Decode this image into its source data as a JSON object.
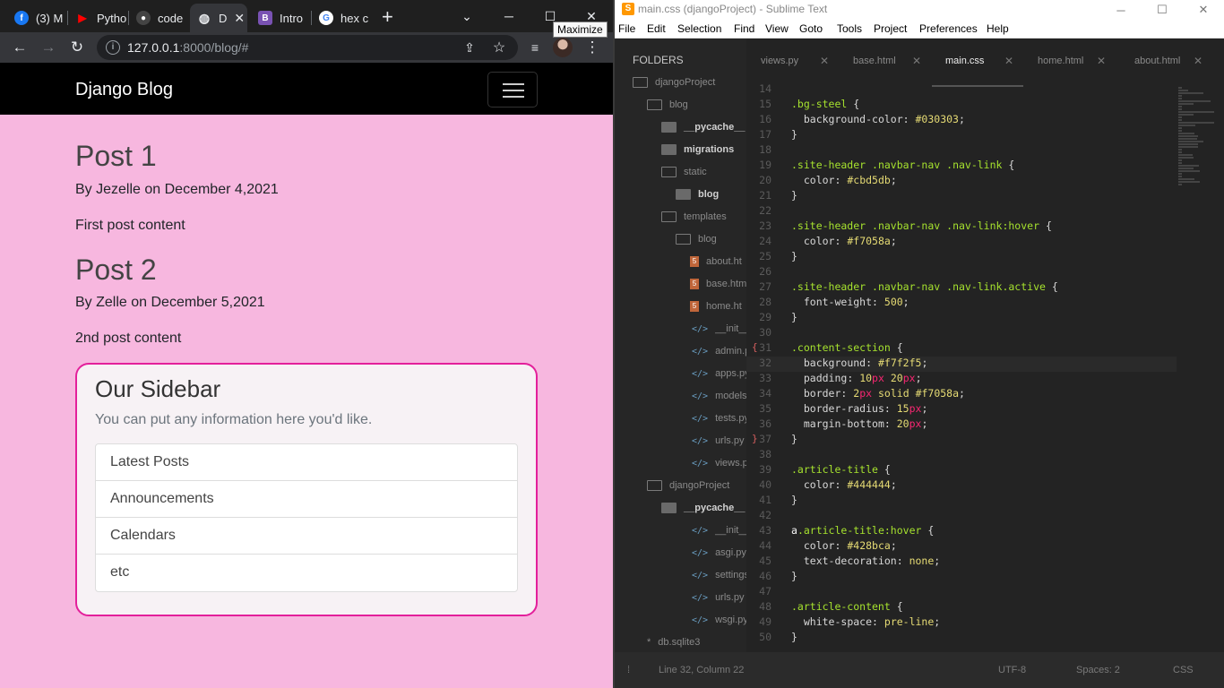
{
  "browser": {
    "tabs": [
      {
        "title": "(3) M",
        "icon": "facebook-icon",
        "color": "#1877f2"
      },
      {
        "title": "Pytho",
        "icon": "youtube-icon",
        "color": "#ff0000"
      },
      {
        "title": "code",
        "icon": "github-icon",
        "color": "#333333"
      },
      {
        "title": "D",
        "icon": "globe-icon",
        "color": "#5f6368"
      },
      {
        "title": "Intro",
        "icon": "bootstrap-icon",
        "color": "#7952b3"
      },
      {
        "title": "hex c",
        "icon": "google-icon",
        "color": "#4285f4"
      }
    ],
    "tooltip": "Maximize",
    "url_host": "127.0.0.1",
    "url_path": ":8000/blog/#"
  },
  "site": {
    "brand": "Django Blog",
    "posts": [
      {
        "title": "Post 1",
        "meta": "By Jezelle on December 4,2021",
        "content": "First post content"
      },
      {
        "title": "Post 2",
        "meta": "By Zelle on December 5,2021",
        "content": "2nd post content"
      }
    ],
    "sidebar": {
      "title": "Our Sidebar",
      "text": "You can put any information here you'd like.",
      "items": [
        "Latest Posts",
        "Announcements",
        "Calendars",
        "etc"
      ]
    }
  },
  "sublime": {
    "title": "main.css (djangoProject) - Sublime Text",
    "menu": [
      "File",
      "Edit",
      "Selection",
      "Find",
      "View",
      "Goto",
      "Tools",
      "Project",
      "Preferences",
      "Help"
    ],
    "folders_header": "FOLDERS",
    "tree": [
      {
        "label": "djangoProject",
        "type": "folder",
        "depth": 0,
        "style": "dim"
      },
      {
        "label": "blog",
        "type": "folder",
        "depth": 1,
        "style": "dim"
      },
      {
        "label": "__pycache__",
        "type": "folder-filled",
        "depth": 2,
        "style": "bold"
      },
      {
        "label": "migrations",
        "type": "folder-filled",
        "depth": 2,
        "style": "bold"
      },
      {
        "label": "static",
        "type": "folder",
        "depth": 2,
        "style": "dim"
      },
      {
        "label": "blog",
        "type": "folder-filled",
        "depth": 3,
        "style": "bold"
      },
      {
        "label": "templates",
        "type": "folder",
        "depth": 2,
        "style": "dim"
      },
      {
        "label": "blog",
        "type": "folder",
        "depth": 3,
        "style": "dim"
      },
      {
        "label": "about.ht",
        "type": "html",
        "depth": 4,
        "style": "dim"
      },
      {
        "label": "base.htm",
        "type": "html",
        "depth": 4,
        "style": "dim"
      },
      {
        "label": "home.ht",
        "type": "html",
        "depth": 4,
        "style": "dim"
      },
      {
        "label": "__init__.py",
        "type": "py",
        "depth": 2,
        "style": "dim"
      },
      {
        "label": "admin.py",
        "type": "py",
        "depth": 2,
        "style": "dim"
      },
      {
        "label": "apps.py",
        "type": "py",
        "depth": 2,
        "style": "dim"
      },
      {
        "label": "models.py",
        "type": "py",
        "depth": 2,
        "style": "dim"
      },
      {
        "label": "tests.py",
        "type": "py",
        "depth": 2,
        "style": "dim"
      },
      {
        "label": "urls.py",
        "type": "py",
        "depth": 2,
        "style": "dim"
      },
      {
        "label": "views.py",
        "type": "py",
        "depth": 2,
        "style": "dim"
      },
      {
        "label": "djangoProject",
        "type": "folder",
        "depth": 1,
        "style": "dim"
      },
      {
        "label": "__pycache__",
        "type": "folder-filled",
        "depth": 2,
        "style": "bold"
      },
      {
        "label": "__init__.py",
        "type": "py",
        "depth": 2,
        "style": "dim"
      },
      {
        "label": "asgi.py",
        "type": "py",
        "depth": 2,
        "style": "dim"
      },
      {
        "label": "settings.py",
        "type": "py",
        "depth": 2,
        "style": "dim"
      },
      {
        "label": "urls.py",
        "type": "py",
        "depth": 2,
        "style": "dim"
      },
      {
        "label": "wsgi.py",
        "type": "py",
        "depth": 2,
        "style": "dim"
      },
      {
        "label": "db.sqlite3",
        "type": "db",
        "depth": 1,
        "style": "dim"
      }
    ],
    "tabs": [
      {
        "label": "views.py",
        "active": false
      },
      {
        "label": "base.html",
        "active": false
      },
      {
        "label": "main.css",
        "active": true
      },
      {
        "label": "home.html",
        "active": false
      },
      {
        "label": "about.html",
        "active": false
      }
    ],
    "code_lines": [
      {
        "n": "14",
        "text": ""
      },
      {
        "n": "15",
        "text": ".bg-steel {"
      },
      {
        "n": "16",
        "text": "  background-color: #030303;"
      },
      {
        "n": "17",
        "text": "}"
      },
      {
        "n": "18",
        "text": ""
      },
      {
        "n": "19",
        "text": ".site-header .navbar-nav .nav-link {"
      },
      {
        "n": "20",
        "text": "  color: #cbd5db;"
      },
      {
        "n": "21",
        "text": "}"
      },
      {
        "n": "22",
        "text": ""
      },
      {
        "n": "23",
        "text": ".site-header .navbar-nav .nav-link:hover {"
      },
      {
        "n": "24",
        "text": "  color: #f7058a;"
      },
      {
        "n": "25",
        "text": "}"
      },
      {
        "n": "26",
        "text": ""
      },
      {
        "n": "27",
        "text": ".site-header .navbar-nav .nav-link.active {"
      },
      {
        "n": "28",
        "text": "  font-weight: 500;"
      },
      {
        "n": "29",
        "text": "}"
      },
      {
        "n": "30",
        "text": ""
      },
      {
        "n": "31",
        "text": ".content-section {"
      },
      {
        "n": "32",
        "text": "  background: #f7f2f5;"
      },
      {
        "n": "33",
        "text": "  padding: 10px 20px;"
      },
      {
        "n": "34",
        "text": "  border: 2px solid #f7058a;"
      },
      {
        "n": "35",
        "text": "  border-radius: 15px;"
      },
      {
        "n": "36",
        "text": "  margin-bottom: 20px;"
      },
      {
        "n": "37",
        "text": "}"
      },
      {
        "n": "38",
        "text": ""
      },
      {
        "n": "39",
        "text": ".article-title {"
      },
      {
        "n": "40",
        "text": "  color: #444444;"
      },
      {
        "n": "41",
        "text": "}"
      },
      {
        "n": "42",
        "text": ""
      },
      {
        "n": "43",
        "text": "a.article-title:hover {"
      },
      {
        "n": "44",
        "text": "  color: #428bca;"
      },
      {
        "n": "45",
        "text": "  text-decoration: none;"
      },
      {
        "n": "46",
        "text": "}"
      },
      {
        "n": "47",
        "text": ""
      },
      {
        "n": "48",
        "text": ".article-content {"
      },
      {
        "n": "49",
        "text": "  white-space: pre-line;"
      },
      {
        "n": "50",
        "text": "}"
      }
    ],
    "highlight_line": "32",
    "status": {
      "position": "Line 32, Column 22",
      "encoding": "UTF-8",
      "spaces": "Spaces: 2",
      "syntax": "CSS"
    }
  }
}
